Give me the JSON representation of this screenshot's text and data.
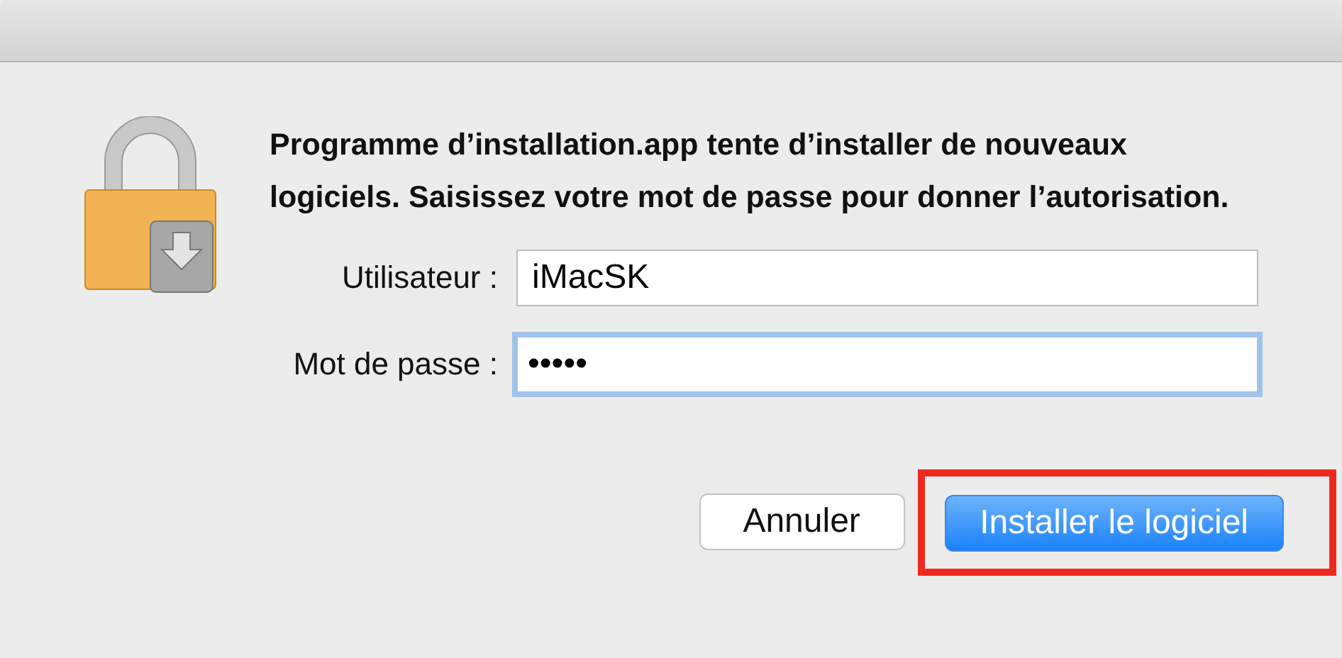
{
  "message": "Programme d’installation.app tente d’installer de nouveaux logiciels. Saisissez votre mot de passe pour donner l’autorisation.",
  "fields": [
    {
      "label": "Utilisateur :",
      "value": "iMacSK",
      "focused": false
    },
    {
      "label": "Mot de passe :",
      "value": "•••••",
      "focused": true
    }
  ],
  "buttons": [
    {
      "label": "Annuler",
      "kind": "cancel",
      "highlighted": false
    },
    {
      "label": "Installer le logiciel",
      "kind": "default",
      "highlighted": true
    }
  ]
}
